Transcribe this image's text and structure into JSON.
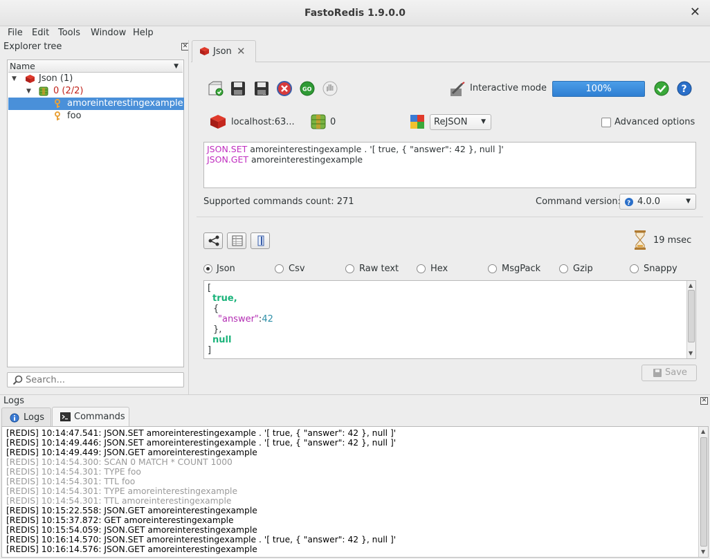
{
  "window": {
    "title": "FastoRedis 1.9.0.0",
    "close": "✕"
  },
  "menu": [
    "File",
    "Edit",
    "Tools",
    "Window",
    "Help"
  ],
  "explorer": {
    "title": "Explorer tree",
    "column": "Name",
    "items": [
      {
        "label": "Json (1)"
      },
      {
        "label": "0 (2/2)"
      },
      {
        "label": "amoreinterestingexample"
      },
      {
        "label": "foo"
      }
    ],
    "search_placeholder": "Search..."
  },
  "tab": {
    "label": "Json"
  },
  "toolbar": {
    "interactive_mode": "Interactive mode",
    "progress": "100%",
    "progress_value": 100,
    "server": "localhost:63...",
    "db_index": "0",
    "module": "ReJSON",
    "advanced": "Advanced options"
  },
  "query": {
    "lines": [
      {
        "cmd": "JSON.SET",
        "rest": " amoreinterestingexample . '[ true, { \"answer\": 42 }, null ]'"
      },
      {
        "cmd": "JSON.GET",
        "rest": " amoreinterestingexample"
      }
    ]
  },
  "info": {
    "supported": "Supported commands count: 271",
    "version_label": "Command version:",
    "version": "4.0.0"
  },
  "result": {
    "time": "19 msec",
    "formats": [
      "Json",
      "Csv",
      "Raw text",
      "Hex",
      "MsgPack",
      "Gzip",
      "Snappy"
    ],
    "selected_format": "Json",
    "json": {
      "open": "[",
      "true": "true,",
      "obj_open": "{",
      "key": "\"answer\"",
      "colon": ":",
      "num": "42",
      "obj_close": "},",
      "null": "null",
      "close": "]"
    },
    "save": "Save"
  },
  "logs": {
    "title": "Logs",
    "tabs": [
      "Logs",
      "Commands"
    ],
    "lines": [
      {
        "text": "[REDIS] 10:14:47.541: JSON.SET amoreinterestingexample . '[ true, { \"answer\": 42 }, null ]'",
        "gray": false
      },
      {
        "text": "[REDIS] 10:14:49.446: JSON.SET amoreinterestingexample . '[ true, { \"answer\": 42 }, null ]'",
        "gray": false
      },
      {
        "text": "[REDIS] 10:14:49.449: JSON.GET amoreinterestingexample",
        "gray": false
      },
      {
        "text": "[REDIS] 10:14:54.300: SCAN 0 MATCH * COUNT 1000",
        "gray": true
      },
      {
        "text": "[REDIS] 10:14:54.301: TYPE foo",
        "gray": true
      },
      {
        "text": "[REDIS] 10:14:54.301: TTL foo",
        "gray": true
      },
      {
        "text": "[REDIS] 10:14:54.301: TYPE amoreinterestingexample",
        "gray": true
      },
      {
        "text": "[REDIS] 10:14:54.301: TTL amoreinterestingexample",
        "gray": true
      },
      {
        "text": "[REDIS] 10:15:22.558: JSON.GET amoreinterestingexample",
        "gray": false
      },
      {
        "text": "[REDIS] 10:15:37.872: GET amoreinterestingexample",
        "gray": false
      },
      {
        "text": "[REDIS] 10:15:54.059: JSON.GET amoreinterestingexample",
        "gray": false
      },
      {
        "text": "[REDIS] 10:16:14.570: JSON.SET amoreinterestingexample . '[ true, { \"answer\": 42 }, null ]'",
        "gray": false
      },
      {
        "text": "[REDIS] 10:16:14.576: JSON.GET amoreinterestingexample",
        "gray": false
      }
    ]
  }
}
